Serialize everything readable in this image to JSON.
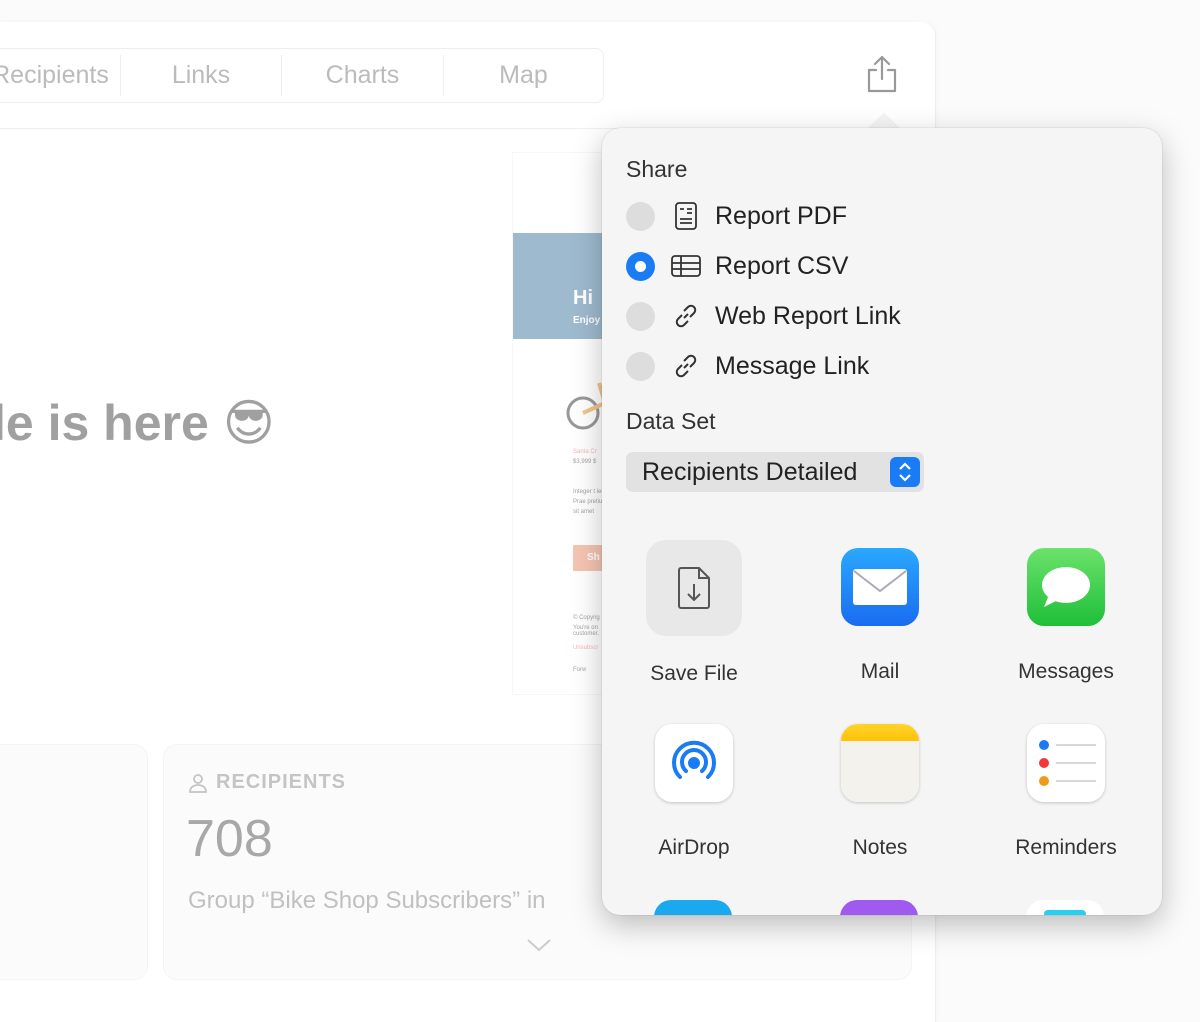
{
  "tabs": [
    {
      "label": "Recipients"
    },
    {
      "label": "Links"
    },
    {
      "label": "Charts"
    },
    {
      "label": "Map"
    }
  ],
  "headline": "le is here 😎",
  "preview": {
    "hi": "Hi",
    "enjoy": "Enjoy",
    "product": "Santa Cr",
    "price": "$3,999 $",
    "body": "Integer t leo. Prae pretium sit amet",
    "button": "Sh",
    "copyright": "© Copyrig",
    "footer": "You're on customer.",
    "unsubscribe": "Unsubscr",
    "forward": "Forw"
  },
  "recipients_card": {
    "label": "RECIPIENTS",
    "count": "708",
    "description": "Group “Bike Shop Subscribers” in"
  },
  "share": {
    "title": "Share",
    "options": [
      {
        "label": "Report PDF",
        "icon": "document-icon",
        "selected": false
      },
      {
        "label": "Report CSV",
        "icon": "table-icon",
        "selected": true
      },
      {
        "label": "Web Report Link",
        "icon": "link-icon",
        "selected": false
      },
      {
        "label": "Message Link",
        "icon": "link-icon",
        "selected": false
      }
    ],
    "dataset_title": "Data Set",
    "dataset_value": "Recipients Detailed",
    "apps": [
      {
        "label": "Save File"
      },
      {
        "label": "Mail"
      },
      {
        "label": "Messages"
      },
      {
        "label": "AirDrop"
      },
      {
        "label": "Notes"
      },
      {
        "label": "Reminders"
      }
    ]
  },
  "colors": {
    "accent": "#1a7cf5",
    "email_header": "#5f8db0"
  }
}
